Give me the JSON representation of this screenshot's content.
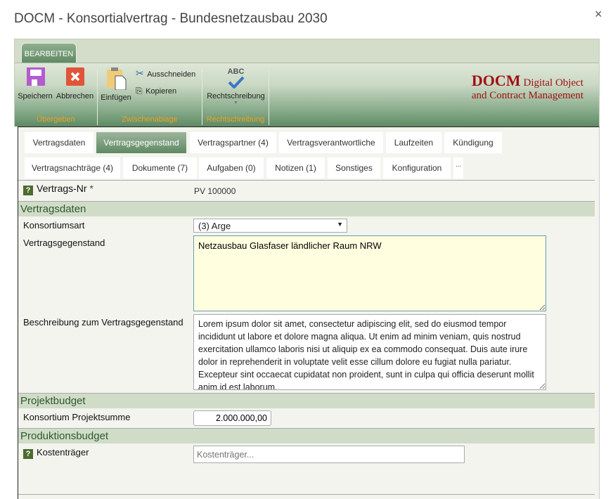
{
  "window": {
    "title": "DOCM - Konsortialvertrag - Bundesnetzausbau 2030",
    "close": "×"
  },
  "ribbon": {
    "tab": "BEARBEITEN",
    "groups": {
      "ubergeben": "Übergeben",
      "zwischenablage": "Zwischenablage",
      "rechtschreibung": "Rechtschreibung"
    },
    "buttons": {
      "save": "Speichern",
      "cancel": "Abbrechen",
      "paste": "Einfügen",
      "cut": "Ausschneiden",
      "copy": "Kopieren",
      "spell": "Rechtschreibung",
      "spell_icon_text": "ABC"
    },
    "logo": {
      "big": "DOCM",
      "line1": "Digital Object",
      "line2": "and Contract Management"
    }
  },
  "tabs": {
    "row1": [
      "Vertragsdaten",
      "Vertragsgegenstand",
      "Vertragspartner (4)",
      "Vertragsverantwortliche",
      "Laufzeiten",
      "Kündigung"
    ],
    "row2": [
      "Vertragsnachträge (4)",
      "Dokumente (7)",
      "Aufgaben (0)",
      "Notizen (1)",
      "Sonstiges",
      "Konfiguration",
      "..."
    ],
    "active": "Vertragsgegenstand"
  },
  "form": {
    "vertrags_nr": {
      "label": "Vertrags-Nr",
      "required": "*",
      "value": "PV 100000",
      "help": "?"
    },
    "sections": {
      "vertragsdaten": "Vertragsdaten",
      "projektbudget": "Projektbudget",
      "produktionsbudget": "Produktionsbudget"
    },
    "konsortiumsart": {
      "label": "Konsortiumsart",
      "value": "(3) Arge"
    },
    "vertragsgegenstand": {
      "label": "Vertragsgegenstand",
      "value": "Netzausbau Glasfaser ländlicher Raum NRW"
    },
    "beschreibung": {
      "label": "Beschreibung zum Vertragsgegenstand",
      "value": "Lorem ipsum dolor sit amet, consectetur adipiscing elit, sed do eiusmod tempor incididunt ut labore et dolore magna aliqua. Ut enim ad minim veniam, quis nostrud exercitation ullamco laboris nisi ut aliquip ex ea commodo consequat. Duis aute irure dolor in reprehenderit in voluptate velit esse cillum dolore eu fugiat nulla pariatur. Excepteur sint occaecat cupidatat non proident, sunt in culpa qui officia deserunt mollit anim id est laborum."
    },
    "projektsumme": {
      "label": "Konsortium Projektsumme",
      "value": "2.000.000,00"
    },
    "kostentraeger": {
      "label": "Kostenträger",
      "placeholder": "Kostenträger...",
      "help": "?"
    }
  },
  "colors": {
    "accent": "#5f8a63",
    "section_bg": "#d0dcc8",
    "group_label": "#f0a020",
    "logo": "#a01010",
    "textarea_active": "#ffffe0"
  }
}
